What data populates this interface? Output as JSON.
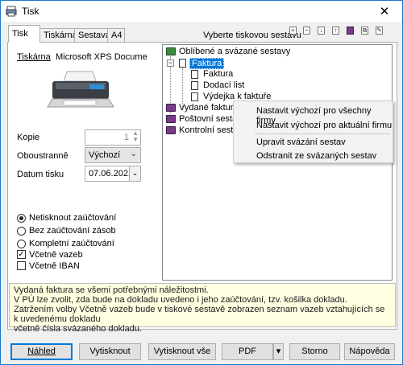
{
  "window": {
    "title": "Tisk",
    "close_glyph": "✕"
  },
  "tabs": [
    {
      "label": "Tisk"
    },
    {
      "label": "Tiskárna"
    },
    {
      "label": "Sestava"
    },
    {
      "label": "A4"
    }
  ],
  "printer": {
    "label": "Tiskárna",
    "name": "Microsoft XPS Document W"
  },
  "copies": {
    "label": "Kopie",
    "value": "1"
  },
  "duplex": {
    "label": "Oboustranně",
    "value": "Výchozí"
  },
  "print_date": {
    "label": "Datum tisku",
    "value": "07.06.2021"
  },
  "accounting_options": [
    {
      "label": "Netisknout zaúčtování",
      "selected": true
    },
    {
      "label": "Bez zaúčtování zásob",
      "selected": false
    },
    {
      "label": "Kompletní zaúčtování",
      "selected": false
    }
  ],
  "checkboxes": [
    {
      "label": "Včetně vazeb",
      "checked": true
    },
    {
      "label": "Včetně IBAN",
      "checked": false
    }
  ],
  "report_panel": {
    "header": "Vyberte tiskovou sestavu"
  },
  "tree": {
    "root": "Oblíbené a svázané sestavy",
    "group_selected": "Faktura",
    "children": [
      "Faktura",
      "Dodací list",
      "Výdejka k faktuře"
    ],
    "others": [
      "Vydané faktury",
      "Poštovní sestavy",
      "Kontrolní sestavy"
    ]
  },
  "context_menu": {
    "items": [
      "Nastavit výchozí pro všechny firmy",
      "Nastavit výchozí pro aktuální firmu",
      "Upravit svázání sestav",
      "Odstranit ze svázaných sestav"
    ]
  },
  "info_lines": [
    "Vydaná faktura se všemi potřebnými náležitostmi.",
    "V PÚ lze zvolit, zda bude na dokladu uvedeno i jeho zaúčtování, tzv. košilka dokladu.",
    "Zatržením volby Včetně vazeb bude v tiskové sestavě zobrazen seznam vazeb vztahujících se k uvedenému dokladu",
    "včetně čísla svázaného dokladu."
  ],
  "buttons": {
    "preview": "Náhled",
    "print": "Vytisknout",
    "print_all": "Vytisknout vše",
    "pdf": "PDF",
    "pdf_arrow": "▾",
    "cancel": "Storno",
    "help": "Nápověda"
  },
  "icons": {
    "combo_arrow": "⌄",
    "check_mark": "✓"
  },
  "colors": {
    "selection": "#0078d7",
    "info_bg": "#ffffe1",
    "window_border": "#1979ca"
  }
}
